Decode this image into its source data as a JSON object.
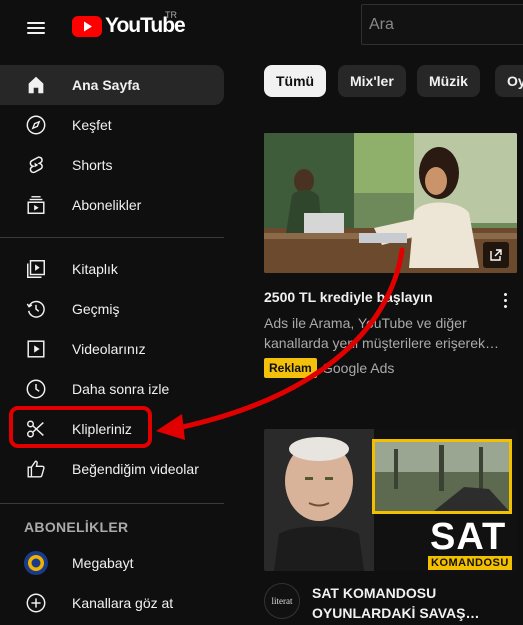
{
  "header": {
    "logo_text": "YouTube",
    "country_code": "TR",
    "search_placeholder": "Ara"
  },
  "sidebar": {
    "main": [
      {
        "label": "Ana Sayfa",
        "icon": "home-icon",
        "active": true
      },
      {
        "label": "Keşfet",
        "icon": "compass-icon"
      },
      {
        "label": "Shorts",
        "icon": "shorts-icon"
      },
      {
        "label": "Abonelikler",
        "icon": "subscriptions-icon"
      }
    ],
    "library": [
      {
        "label": "Kitaplık",
        "icon": "library-icon"
      },
      {
        "label": "Geçmiş",
        "icon": "history-icon"
      },
      {
        "label": "Videolarınız",
        "icon": "your-videos-icon"
      },
      {
        "label": "Daha sonra izle",
        "icon": "watch-later-icon"
      },
      {
        "label": "Klipleriniz",
        "icon": "scissors-icon",
        "highlighted": true
      },
      {
        "label": "Beğendiğim videolar",
        "icon": "thumbs-up-icon"
      }
    ],
    "subscriptions_title": "ABONELİKLER",
    "subscriptions": [
      {
        "label": "Megabayt",
        "icon": "channel-avatar"
      },
      {
        "label": "Kanallara göz at",
        "icon": "add-circle-icon"
      }
    ]
  },
  "chips": [
    "Tümü",
    "Mix'ler",
    "Müzik",
    "Oy"
  ],
  "cards": [
    {
      "title": "2500 TL krediyle başlayın",
      "description_line1": "Ads ile Arama, YouTube ve diğer",
      "description_line2": "kanallarda yeni müşterilere erişerek…",
      "badge": "Reklam",
      "source": "Google Ads"
    },
    {
      "thumbnail_title": "SAT",
      "thumbnail_subtitle": "KOMANDOSU",
      "channel_avatar_text": "literat",
      "title_line1": "SAT KOMANDOSU",
      "title_line2": "OYUNLARDAKİ SAVAŞ…"
    }
  ],
  "colors": {
    "background": "#0f0f0f",
    "accent_red": "#ff0000",
    "annotation_red": "#e10000",
    "ad_badge": "#f3c00b"
  }
}
